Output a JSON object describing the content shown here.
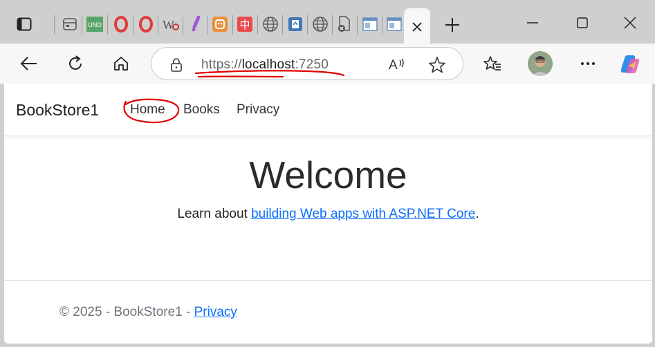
{
  "browser": {
    "active_tab_close": "close tab",
    "address": {
      "scheme": "https://",
      "host": "localhost",
      "port": ":7250"
    },
    "icons": [
      "tab-actions-icon",
      "collections-icon",
      "und-icon",
      "opera-icon",
      "opera-icon",
      "w-icon",
      "brush-icon",
      "plug-icon",
      "input-icon",
      "globe-icon",
      "bookmark-icon",
      "globe-icon",
      "blocked-file-icon",
      "window-icon",
      "window-icon"
    ]
  },
  "site": {
    "brand": "BookStore1",
    "nav": {
      "home": "Home",
      "books": "Books",
      "privacy": "Privacy"
    },
    "heading": "Welcome",
    "learn_prefix": "Learn about ",
    "learn_link": "building Web apps with ASP.NET Core",
    "learn_suffix": ".",
    "footer_text": "© 2025 - BookStore1 - ",
    "footer_link": "Privacy"
  },
  "colors": {
    "link": "#0d6efd",
    "annotation": "#e00000"
  }
}
